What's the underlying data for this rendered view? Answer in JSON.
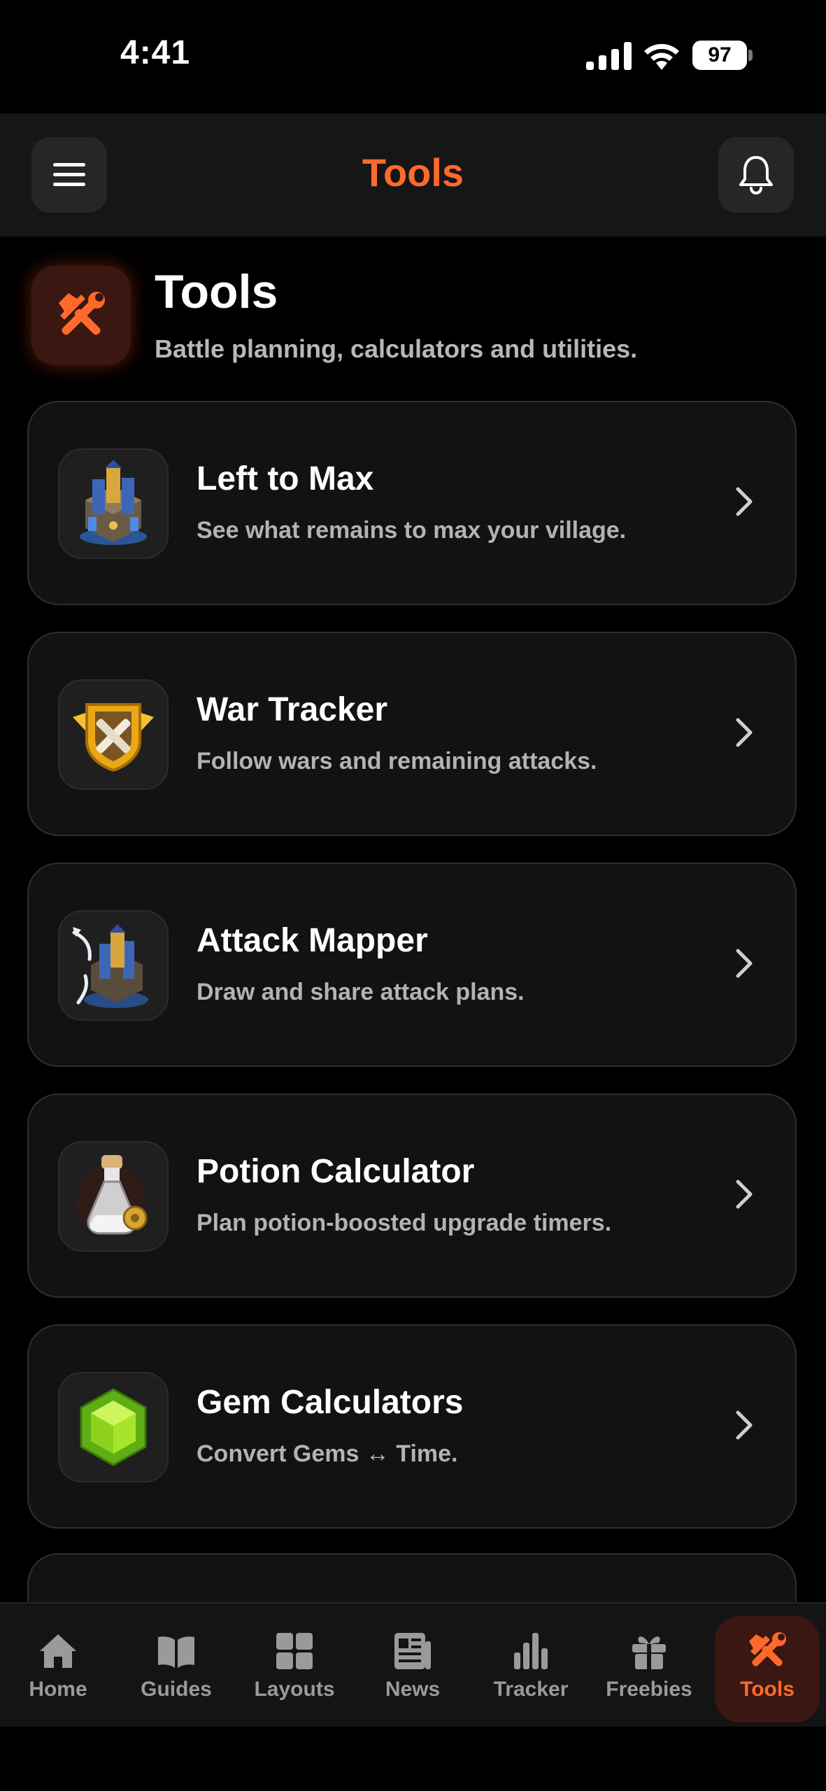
{
  "status_bar": {
    "time": "4:41",
    "battery": "97"
  },
  "header": {
    "title": "Tools"
  },
  "page": {
    "title": "Tools",
    "subtitle": "Battle planning, calculators and utilities."
  },
  "tools": [
    {
      "title": "Left to Max",
      "description": "See what remains to max your village.",
      "icon": "village-icon"
    },
    {
      "title": "War Tracker",
      "description": "Follow wars and remaining attacks.",
      "icon": "war-badge-icon"
    },
    {
      "title": "Attack Mapper",
      "description": "Draw and share attack plans.",
      "icon": "attack-map-icon"
    },
    {
      "title": "Potion Calculator",
      "description": "Plan potion-boosted upgrade timers.",
      "icon": "potion-icon"
    },
    {
      "title": "Gem Calculators",
      "description": "Convert Gems ↔ Time.",
      "icon": "gem-icon"
    }
  ],
  "tab_bar": {
    "tabs": [
      {
        "label": "Home",
        "icon": "home-icon"
      },
      {
        "label": "Guides",
        "icon": "book-icon"
      },
      {
        "label": "Layouts",
        "icon": "grid-icon"
      },
      {
        "label": "News",
        "icon": "newspaper-icon"
      },
      {
        "label": "Tracker",
        "icon": "bar-chart-icon"
      },
      {
        "label": "Freebies",
        "icon": "gift-icon"
      },
      {
        "label": "Tools",
        "icon": "tools-icon"
      }
    ],
    "active": "Tools"
  },
  "colors": {
    "accent": "#ff6a2c",
    "background": "#000000",
    "card": "#121212"
  }
}
